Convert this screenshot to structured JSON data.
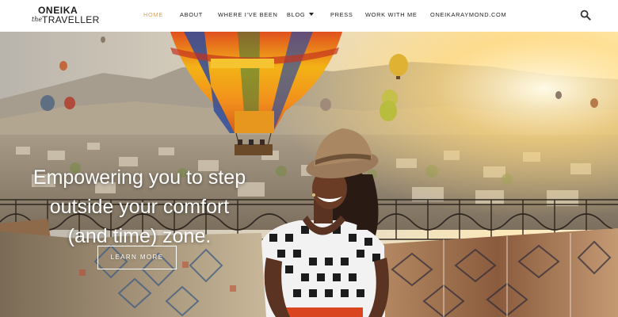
{
  "site": {
    "logo": {
      "line1": "ONEIKA",
      "the": "the",
      "line2": "TRAVELLER"
    }
  },
  "nav": {
    "items": [
      {
        "label": "HOME",
        "active": true
      },
      {
        "label": "ABOUT",
        "active": false
      },
      {
        "label": "WHERE I'VE BEEN",
        "active": false
      },
      {
        "label": "BLOG",
        "active": false,
        "has_dropdown": true
      },
      {
        "label": "PRESS",
        "active": false
      },
      {
        "label": "WORK WITH ME",
        "active": false
      },
      {
        "label": "ONEIKARAYMOND.COM",
        "active": false
      }
    ],
    "search_icon": "search-icon"
  },
  "hero": {
    "headline_lines": [
      "Empowering you to step",
      "outside your comfort",
      "(and time) zone."
    ],
    "cta_label": "LEARN MORE",
    "image": "woman-on-rooftop-with-hot-air-balloons"
  },
  "colors": {
    "accent": "#d4a25a",
    "nav_text": "#222222",
    "hero_text": "#ffffff"
  }
}
